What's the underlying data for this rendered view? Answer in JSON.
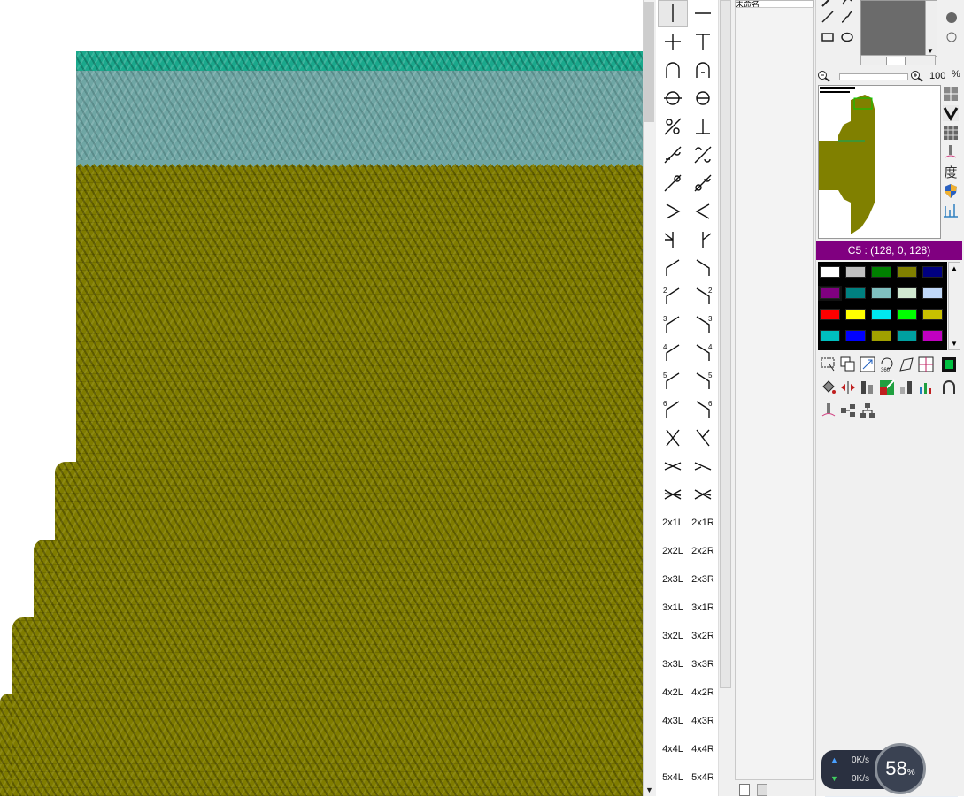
{
  "canvas": {
    "colors": {
      "main": "#7f7c00",
      "band": "#6fa6a4",
      "rib": "#1aa88c"
    }
  },
  "stitch_palette": {
    "rows": [
      {
        "left": "vline",
        "right": "hline"
      },
      {
        "left": "plus",
        "right": "tee"
      },
      {
        "left": "arch",
        "right": "arch-dot"
      },
      {
        "left": "circle-bar",
        "right": "circle-half"
      },
      {
        "left": "slash-circle",
        "right": "inverted-tee"
      },
      {
        "left": "slash-b",
        "right": "slash-c"
      },
      {
        "left": "slash-o",
        "right": "slash-o2"
      },
      {
        "left": "greater-than",
        "right": "less-than"
      },
      {
        "left": "lean-left-y",
        "right": "lean-right-y"
      },
      {
        "left": "bend-left",
        "right": "bend-right"
      },
      {
        "left": "bend-left-2",
        "right": "bend-right-2"
      },
      {
        "left": "bend-left-3",
        "right": "bend-right-3"
      },
      {
        "left": "bend-left-4",
        "right": "bend-right-4"
      },
      {
        "left": "bend-left-5",
        "right": "bend-right-5"
      },
      {
        "left": "bend-left-6",
        "right": "bend-right-6"
      },
      {
        "left": "cross-x",
        "right": "cross-x2"
      },
      {
        "left": "cable-a",
        "right": "cable-b"
      },
      {
        "left": "cable-c",
        "right": "cable-d"
      }
    ],
    "digits": [
      "",
      "",
      "",
      "",
      "",
      "",
      "",
      "",
      "",
      "",
      "2",
      "3",
      "4",
      "5",
      "6"
    ],
    "cable_labels": [
      [
        "2x1L",
        "2x1R"
      ],
      [
        "2x2L",
        "2x2R"
      ],
      [
        "2x3L",
        "2x3R"
      ],
      [
        "3x1L",
        "3x1R"
      ],
      [
        "3x2L",
        "3x2R"
      ],
      [
        "3x3L",
        "3x3R"
      ],
      [
        "4x2L",
        "4x2R"
      ],
      [
        "4x3L",
        "4x3R"
      ],
      [
        "4x4L",
        "4x4R"
      ],
      [
        "5x4L",
        "5x4R"
      ]
    ]
  },
  "mid_panel": {
    "combo_text": "未命名"
  },
  "right_panel": {
    "zoom_value": "100",
    "zoom_unit": "%",
    "color_info": "C5 : (128, 0, 128)",
    "swatches": [
      [
        "#ffffff",
        "#c0c0c0",
        "#008000",
        "#808000",
        "#000080"
      ],
      [
        "#800080",
        "#008080",
        "#80c0c0",
        "#d0e8d0",
        "#c0d8f8"
      ],
      [
        "#ff0000",
        "#ffff00",
        "#00e8f0",
        "#00ff00",
        "#c8c000"
      ],
      [
        "#00c0c0",
        "#0000ff",
        "#a0a000",
        "#00a0a0",
        "#c000c0"
      ]
    ],
    "selected_swatch": "1,0",
    "vtool_icons": [
      "grid-icon",
      "v-stitch-icon",
      "grid-small-icon",
      "needle-icon",
      "degree-icon",
      "shield-icon",
      "chart-lines-icon"
    ],
    "degree_char": "度"
  },
  "system_monitor": {
    "upload": "0K/s",
    "download": "0K/s",
    "cpu_value": "58",
    "cpu_unit": "%"
  }
}
